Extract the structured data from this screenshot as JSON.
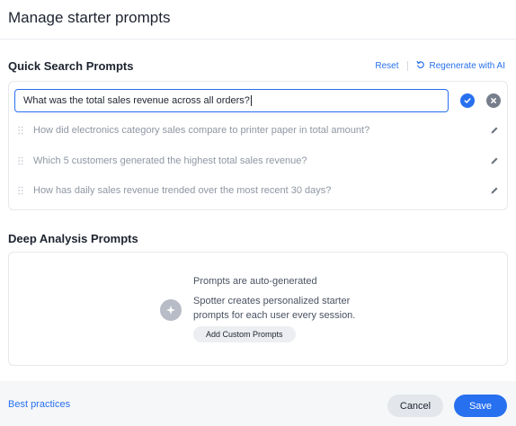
{
  "dialog": {
    "title": "Manage starter prompts"
  },
  "quick_search": {
    "title": "Quick Search Prompts",
    "reset_label": "Reset",
    "regenerate_label": "Regenerate with AI",
    "editing_value": "What was the total sales revenue across all orders?",
    "prompts": [
      "How did electronics category sales compare to printer paper in total amount?",
      "Which 5 customers generated the highest total sales revenue?",
      "How has daily sales revenue trended over the most recent 30 days?"
    ]
  },
  "deep_analysis": {
    "title": "Deep Analysis Prompts",
    "auto_title": "Prompts are auto-generated",
    "auto_desc": "Spotter creates personalized starter prompts for each user every session.",
    "add_button": "Add Custom Prompts"
  },
  "footer": {
    "best_practices": "Best practices",
    "cancel": "Cancel",
    "save": "Save"
  },
  "colors": {
    "accent": "#2770ef",
    "text": "#1d232f",
    "muted": "#8f96a3",
    "footer_bg": "#f6f7f9"
  },
  "icons": {
    "confirm": "check-circle-icon",
    "cancel": "close-circle-icon",
    "regenerate": "regenerate-icon",
    "drag": "drag-handle-icon",
    "edit": "pencil-icon",
    "sparkle": "sparkle-icon"
  }
}
